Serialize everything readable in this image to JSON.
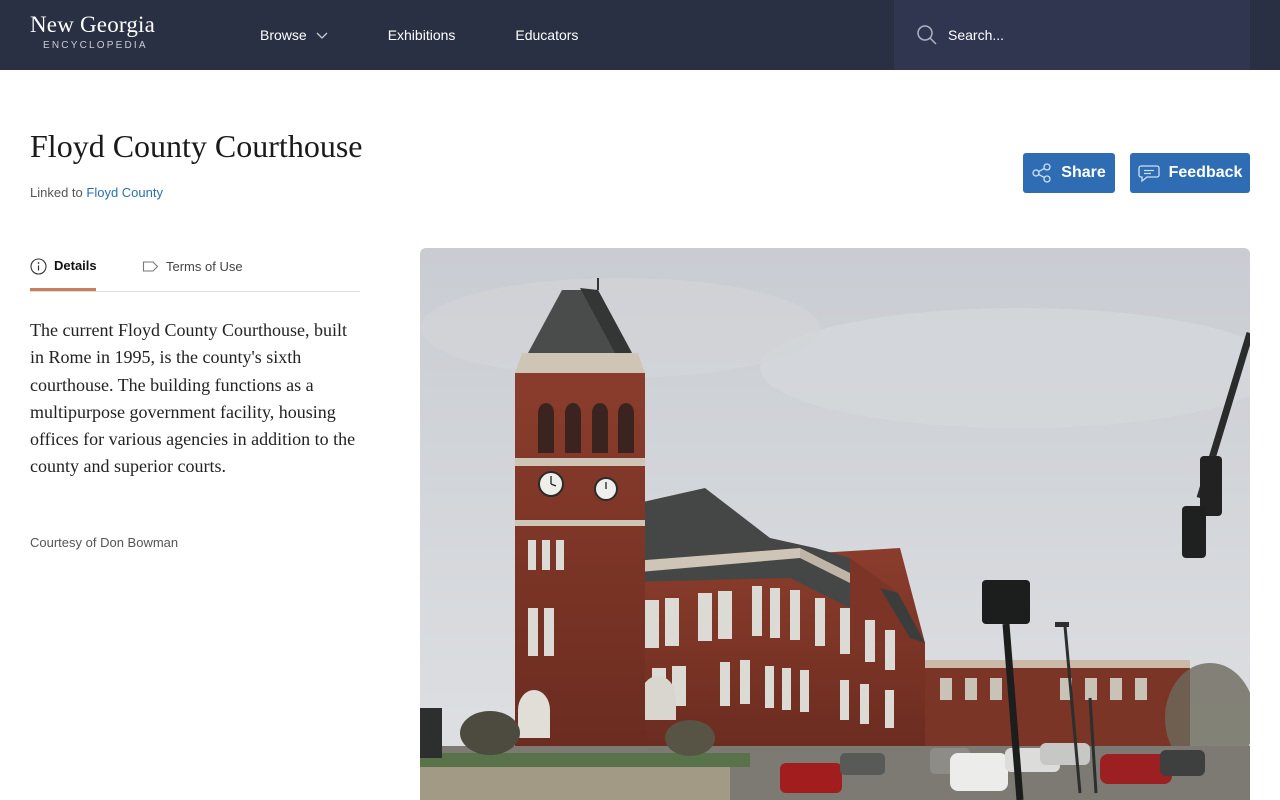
{
  "header": {
    "logo_main": "New Georgia",
    "logo_sub": "ENCYCLOPEDIA",
    "nav": [
      {
        "label": "Browse"
      },
      {
        "label": "Exhibitions"
      },
      {
        "label": "Educators"
      }
    ],
    "search_placeholder": "Search..."
  },
  "page": {
    "title": "Floyd County Courthouse",
    "linked_prefix": "Linked to",
    "linked_link": "Floyd County",
    "share_label": "Share",
    "feedback_label": "Feedback"
  },
  "tabs": [
    {
      "label": "Details",
      "active": true
    },
    {
      "label": "Terms of Use",
      "active": false
    }
  ],
  "details": {
    "description": "The current Floyd County Courthouse, built in Rome in 1995, is the county's sixth courthouse. The building functions as a multipurpose government facility, housing offices for various agencies in addition to the county and superior courts.",
    "credit": "Courtesy of Don Bowman"
  },
  "icons": {
    "chevron": "chevron-down-icon",
    "search": "search-icon",
    "share": "share-icon",
    "feedback": "speech-bubble-icon",
    "info": "info-icon",
    "tag": "tag-icon"
  },
  "colors": {
    "header_bg": "#2a3044",
    "search_bg": "#303650",
    "button_bg": "#2e6db4",
    "link": "#2a6fb0",
    "tab_underline": "#c8805a"
  }
}
